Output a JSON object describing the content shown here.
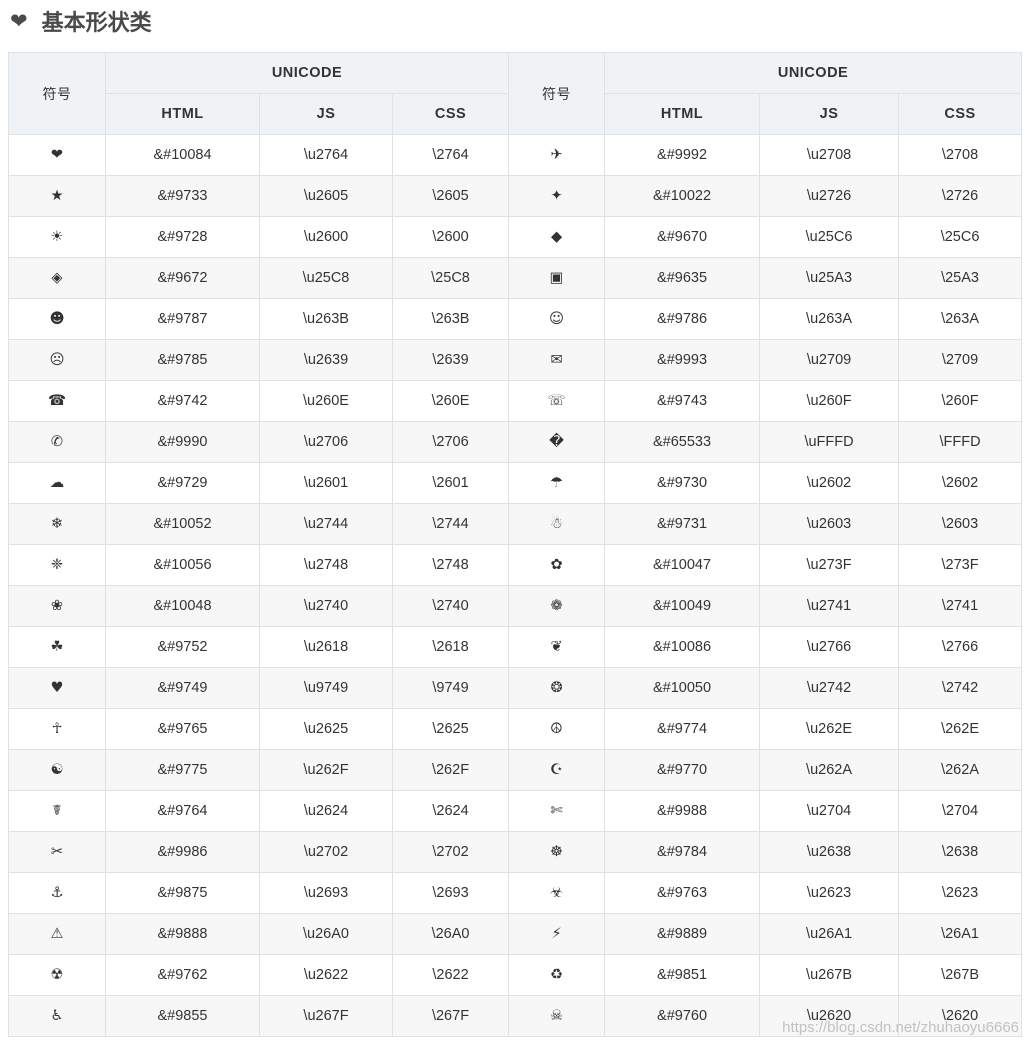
{
  "heading": {
    "icon": "heart-icon",
    "icon_glyph": "❤",
    "title": "基本形状类"
  },
  "table": {
    "header": {
      "symbol": "符号",
      "unicode": "UNICODE",
      "html": "HTML",
      "js": "JS",
      "css": "CSS"
    },
    "rows": [
      {
        "l": {
          "sym": "❤",
          "html": "&#10084",
          "js": "\\u2764",
          "css": "\\2764"
        },
        "r": {
          "sym": "✈",
          "html": "&#9992",
          "js": "\\u2708",
          "css": "\\2708"
        }
      },
      {
        "l": {
          "sym": "★",
          "html": "&#9733",
          "js": "\\u2605",
          "css": "\\2605"
        },
        "r": {
          "sym": "✦",
          "html": "&#10022",
          "js": "\\u2726",
          "css": "\\2726"
        }
      },
      {
        "l": {
          "sym": "☀",
          "html": "&#9728",
          "js": "\\u2600",
          "css": "\\2600"
        },
        "r": {
          "sym": "◆",
          "html": "&#9670",
          "js": "\\u25C6",
          "css": "\\25C6"
        }
      },
      {
        "l": {
          "sym": "◈",
          "html": "&#9672",
          "js": "\\u25C8",
          "css": "\\25C8"
        },
        "r": {
          "sym": "▣",
          "html": "&#9635",
          "js": "\\u25A3",
          "css": "\\25A3"
        }
      },
      {
        "l": {
          "sym": "☻",
          "html": "&#9787",
          "js": "\\u263B",
          "css": "\\263B"
        },
        "r": {
          "sym": "☺",
          "html": "&#9786",
          "js": "\\u263A",
          "css": "\\263A"
        }
      },
      {
        "l": {
          "sym": "☹",
          "html": "&#9785",
          "js": "\\u2639",
          "css": "\\2639"
        },
        "r": {
          "sym": "✉",
          "html": "&#9993",
          "js": "\\u2709",
          "css": "\\2709"
        }
      },
      {
        "l": {
          "sym": "☎",
          "html": "&#9742",
          "js": "\\u260E",
          "css": "\\260E"
        },
        "r": {
          "sym": "☏",
          "html": "&#9743",
          "js": "\\u260F",
          "css": "\\260F"
        }
      },
      {
        "l": {
          "sym": "✆",
          "html": "&#9990",
          "js": "\\u2706",
          "css": "\\2706"
        },
        "r": {
          "sym": "�",
          "html": "&#65533",
          "js": "\\uFFFD",
          "css": "\\FFFD"
        }
      },
      {
        "l": {
          "sym": "☁",
          "html": "&#9729",
          "js": "\\u2601",
          "css": "\\2601"
        },
        "r": {
          "sym": "☂",
          "html": "&#9730",
          "js": "\\u2602",
          "css": "\\2602"
        }
      },
      {
        "l": {
          "sym": "❄",
          "html": "&#10052",
          "js": "\\u2744",
          "css": "\\2744"
        },
        "r": {
          "sym": "☃",
          "html": "&#9731",
          "js": "\\u2603",
          "css": "\\2603"
        }
      },
      {
        "l": {
          "sym": "❈",
          "html": "&#10056",
          "js": "\\u2748",
          "css": "\\2748"
        },
        "r": {
          "sym": "✿",
          "html": "&#10047",
          "js": "\\u273F",
          "css": "\\273F"
        }
      },
      {
        "l": {
          "sym": "❀",
          "html": "&#10048",
          "js": "\\u2740",
          "css": "\\2740"
        },
        "r": {
          "sym": "❁",
          "html": "&#10049",
          "js": "\\u2741",
          "css": "\\2741"
        }
      },
      {
        "l": {
          "sym": "☘",
          "html": "&#9752",
          "js": "\\u2618",
          "css": "\\2618"
        },
        "r": {
          "sym": "❦",
          "html": "&#10086",
          "js": "\\u2766",
          "css": "\\2766"
        }
      },
      {
        "l": {
          "sym": "♥",
          "html": "&#9749",
          "js": "\\u9749",
          "css": "\\9749"
        },
        "r": {
          "sym": "❂",
          "html": "&#10050",
          "js": "\\u2742",
          "css": "\\2742"
        }
      },
      {
        "l": {
          "sym": "☥",
          "html": "&#9765",
          "js": "\\u2625",
          "css": "\\2625"
        },
        "r": {
          "sym": "☮",
          "html": "&#9774",
          "js": "\\u262E",
          "css": "\\262E"
        }
      },
      {
        "l": {
          "sym": "☯",
          "html": "&#9775",
          "js": "\\u262F",
          "css": "\\262F"
        },
        "r": {
          "sym": "☪",
          "html": "&#9770",
          "js": "\\u262A",
          "css": "\\262A"
        }
      },
      {
        "l": {
          "sym": "☤",
          "html": "&#9764",
          "js": "\\u2624",
          "css": "\\2624"
        },
        "r": {
          "sym": "✄",
          "html": "&#9988",
          "js": "\\u2704",
          "css": "\\2704"
        }
      },
      {
        "l": {
          "sym": "✂",
          "html": "&#9986",
          "js": "\\u2702",
          "css": "\\2702"
        },
        "r": {
          "sym": "☸",
          "html": "&#9784",
          "js": "\\u2638",
          "css": "\\2638"
        }
      },
      {
        "l": {
          "sym": "⚓",
          "html": "&#9875",
          "js": "\\u2693",
          "css": "\\2693"
        },
        "r": {
          "sym": "☣",
          "html": "&#9763",
          "js": "\\u2623",
          "css": "\\2623"
        }
      },
      {
        "l": {
          "sym": "⚠",
          "html": "&#9888",
          "js": "\\u26A0",
          "css": "\\26A0"
        },
        "r": {
          "sym": "⚡",
          "html": "&#9889",
          "js": "\\u26A1",
          "css": "\\26A1"
        }
      },
      {
        "l": {
          "sym": "☢",
          "html": "&#9762",
          "js": "\\u2622",
          "css": "\\2622"
        },
        "r": {
          "sym": "♻",
          "html": "&#9851",
          "js": "\\u267B",
          "css": "\\267B"
        }
      },
      {
        "l": {
          "sym": "♿",
          "html": "&#9855",
          "js": "\\u267F",
          "css": "\\267F"
        },
        "r": {
          "sym": "☠",
          "html": "&#9760",
          "js": "\\u2620",
          "css": "\\2620"
        }
      }
    ]
  },
  "watermark": "https://blog.csdn.net/zhuhaoyu6666"
}
